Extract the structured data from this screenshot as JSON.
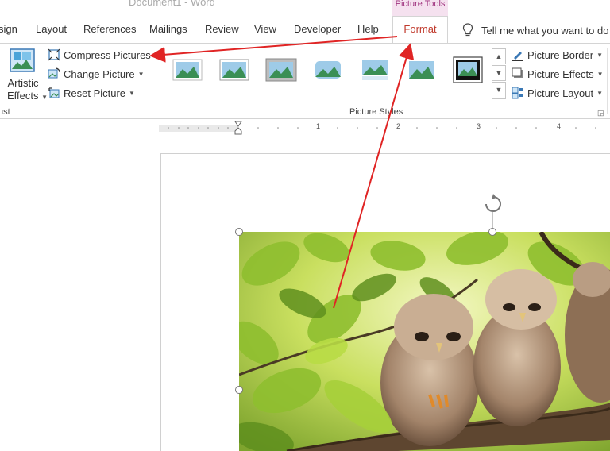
{
  "title": "Document1  -  Word",
  "context_tab": "Picture Tools",
  "tabs": {
    "design": "sign",
    "layout": "Layout",
    "references": "References",
    "mailings": "Mailings",
    "review": "Review",
    "view": "View",
    "developer": "Developer",
    "help": "Help",
    "format": "Format"
  },
  "tell_me": "Tell me what you want to do",
  "adjust": {
    "artistic_effects_line1": "Artistic",
    "artistic_effects_line2": "Effects",
    "compress_pictures": "Compress Pictures",
    "change_picture": "Change Picture",
    "reset_picture": "Reset Picture",
    "group_label": "ust"
  },
  "picture_styles": {
    "group_label": "Picture Styles",
    "picture_border": "Picture Border",
    "picture_effects": "Picture Effects",
    "picture_layout": "Picture Layout"
  },
  "ruler": {
    "numbers": [
      "1",
      "2",
      "3",
      "4"
    ]
  },
  "colors": {
    "accent_red": "#e02424",
    "format_tab": "#c0392b",
    "context_tab_bg": "#f5e1ef"
  }
}
